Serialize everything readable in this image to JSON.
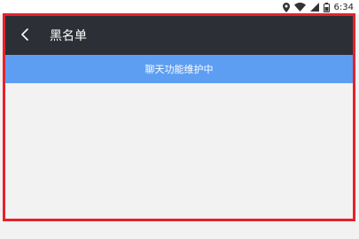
{
  "status_bar": {
    "time": "6:34",
    "icons": [
      "location-icon",
      "wifi-icon",
      "signal-icon",
      "battery-icon"
    ]
  },
  "app_bar": {
    "back_icon": "chevron-left-icon",
    "title": "黑名单"
  },
  "notice": {
    "text": "聊天功能维护中"
  },
  "colors": {
    "app_bar_bg": "#2d2f36",
    "notice_bg": "#5d9ef3",
    "highlight_border": "#e8212a",
    "page_bg": "#f2f2f2"
  }
}
